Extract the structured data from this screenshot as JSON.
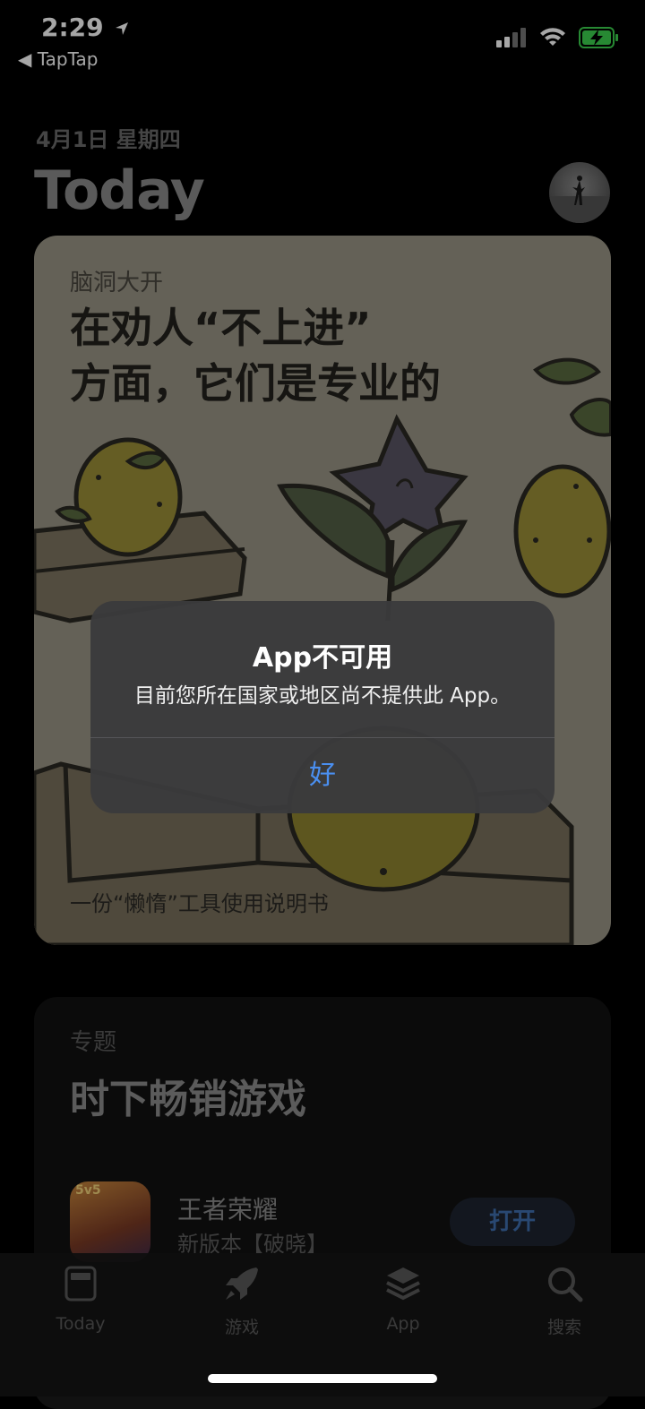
{
  "status_bar": {
    "time": "2:29",
    "back_app": "TapTap"
  },
  "header": {
    "date": "4月1日 星期四",
    "title": "Today"
  },
  "feature_card": {
    "kicker": "脑洞大开",
    "headline_line1": "在劝人“不上进”",
    "headline_line2": "方面，它们是专业的",
    "footer": "一份“懒惰”工具使用说明书"
  },
  "topic_card": {
    "kicker": "专题",
    "title": "时下畅销游戏",
    "app": {
      "icon_tag": "5v5",
      "name": "王者荣耀",
      "subtitle": "新版本【破晓】",
      "action": "打开"
    }
  },
  "alert": {
    "title": "App不可用",
    "message": "目前您所在国家或地区尚不提供此 App。",
    "button": "好"
  },
  "tab_bar": {
    "items": [
      {
        "label": "Today",
        "icon": "today-icon"
      },
      {
        "label": "游戏",
        "icon": "rocket-icon"
      },
      {
        "label": "App",
        "icon": "layers-icon"
      },
      {
        "label": "搜索",
        "icon": "search-icon"
      }
    ]
  }
}
